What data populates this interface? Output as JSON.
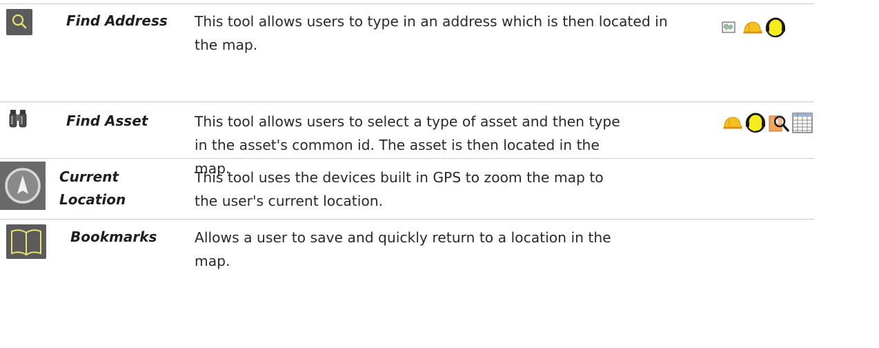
{
  "tools": [
    {
      "name": "Find Address",
      "description": "This tool allows users to type in an address which is then located in the map.",
      "tool_icon": "magnifier-icon",
      "role_icons": [
        "map-icon",
        "hard-hat-icon",
        "headset-icon"
      ]
    },
    {
      "name": "Find Asset",
      "description": "This tool allows users to select a type of asset and then type in the asset's common id. The asset is then located in the map.",
      "tool_icon": "binoculars-icon",
      "role_icons": [
        "hard-hat-icon",
        "headset-icon",
        "inspector-icon",
        "table-icon"
      ]
    },
    {
      "name": "Current Location",
      "name_line1": "Current",
      "name_line2": "Location",
      "description": "This tool uses the devices built in GPS to zoom the map to the user's current location.",
      "tool_icon": "compass-icon",
      "role_icons": []
    },
    {
      "name": "Bookmarks",
      "description": "Allows a user to save and quickly return to a location in the map.",
      "tool_icon": "book-icon",
      "role_icons": []
    }
  ],
  "colors": {
    "icon_bg": "#5b5b5b",
    "icon_yellow": "#e8e36a",
    "hat_orange": "#f0a21c",
    "rule": "#c9c9c9"
  }
}
